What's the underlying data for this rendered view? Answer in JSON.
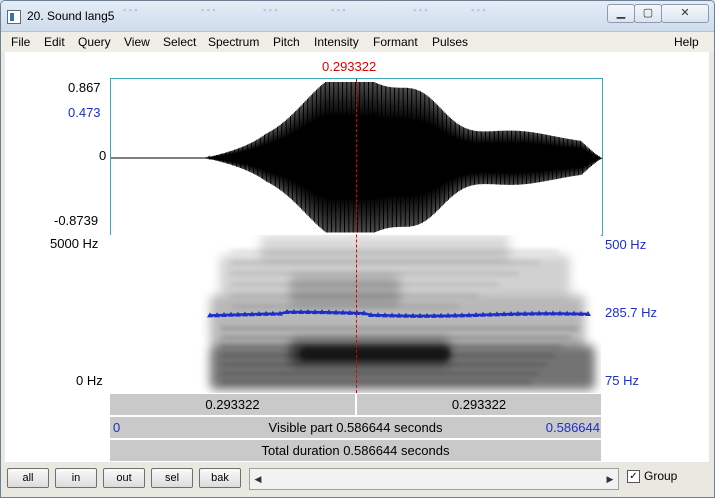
{
  "window": {
    "title": "20. Sound lang5"
  },
  "menu": [
    "File",
    "Edit",
    "Query",
    "View",
    "Select",
    "Spectrum",
    "Pitch",
    "Intensity",
    "Formant",
    "Pulses",
    "Help"
  ],
  "cursor": {
    "time_label": "0.293322",
    "fraction": 0.5
  },
  "waveform": {
    "max_label": "0.867",
    "cursor_value_label": "0.473",
    "zero_label": "0",
    "min_label": "-0.8739"
  },
  "spectrogram": {
    "top_label": "5000 Hz",
    "bottom_label": "0 Hz"
  },
  "pitch": {
    "top_label": "500 Hz",
    "value_label": "285.7 Hz",
    "bottom_label": "75 Hz",
    "range_hz": [
      75,
      500
    ],
    "value_hz": 285.7
  },
  "timebar": {
    "left_label": "0.293322",
    "right_label": "0.293322"
  },
  "visible_bar": {
    "start": "0",
    "text": "Visible part 0.586644 seconds",
    "end": "0.586644"
  },
  "total_bar": {
    "text": "Total duration 0.586644 seconds"
  },
  "buttons": {
    "all": "all",
    "in": "in",
    "out": "out",
    "sel": "sel",
    "bak": "bak"
  },
  "group": {
    "label": "Group",
    "checked": true
  },
  "colors": {
    "cursor": "#e00000",
    "pitch": "#1c2fcb",
    "frame": "#3aa9b8"
  }
}
